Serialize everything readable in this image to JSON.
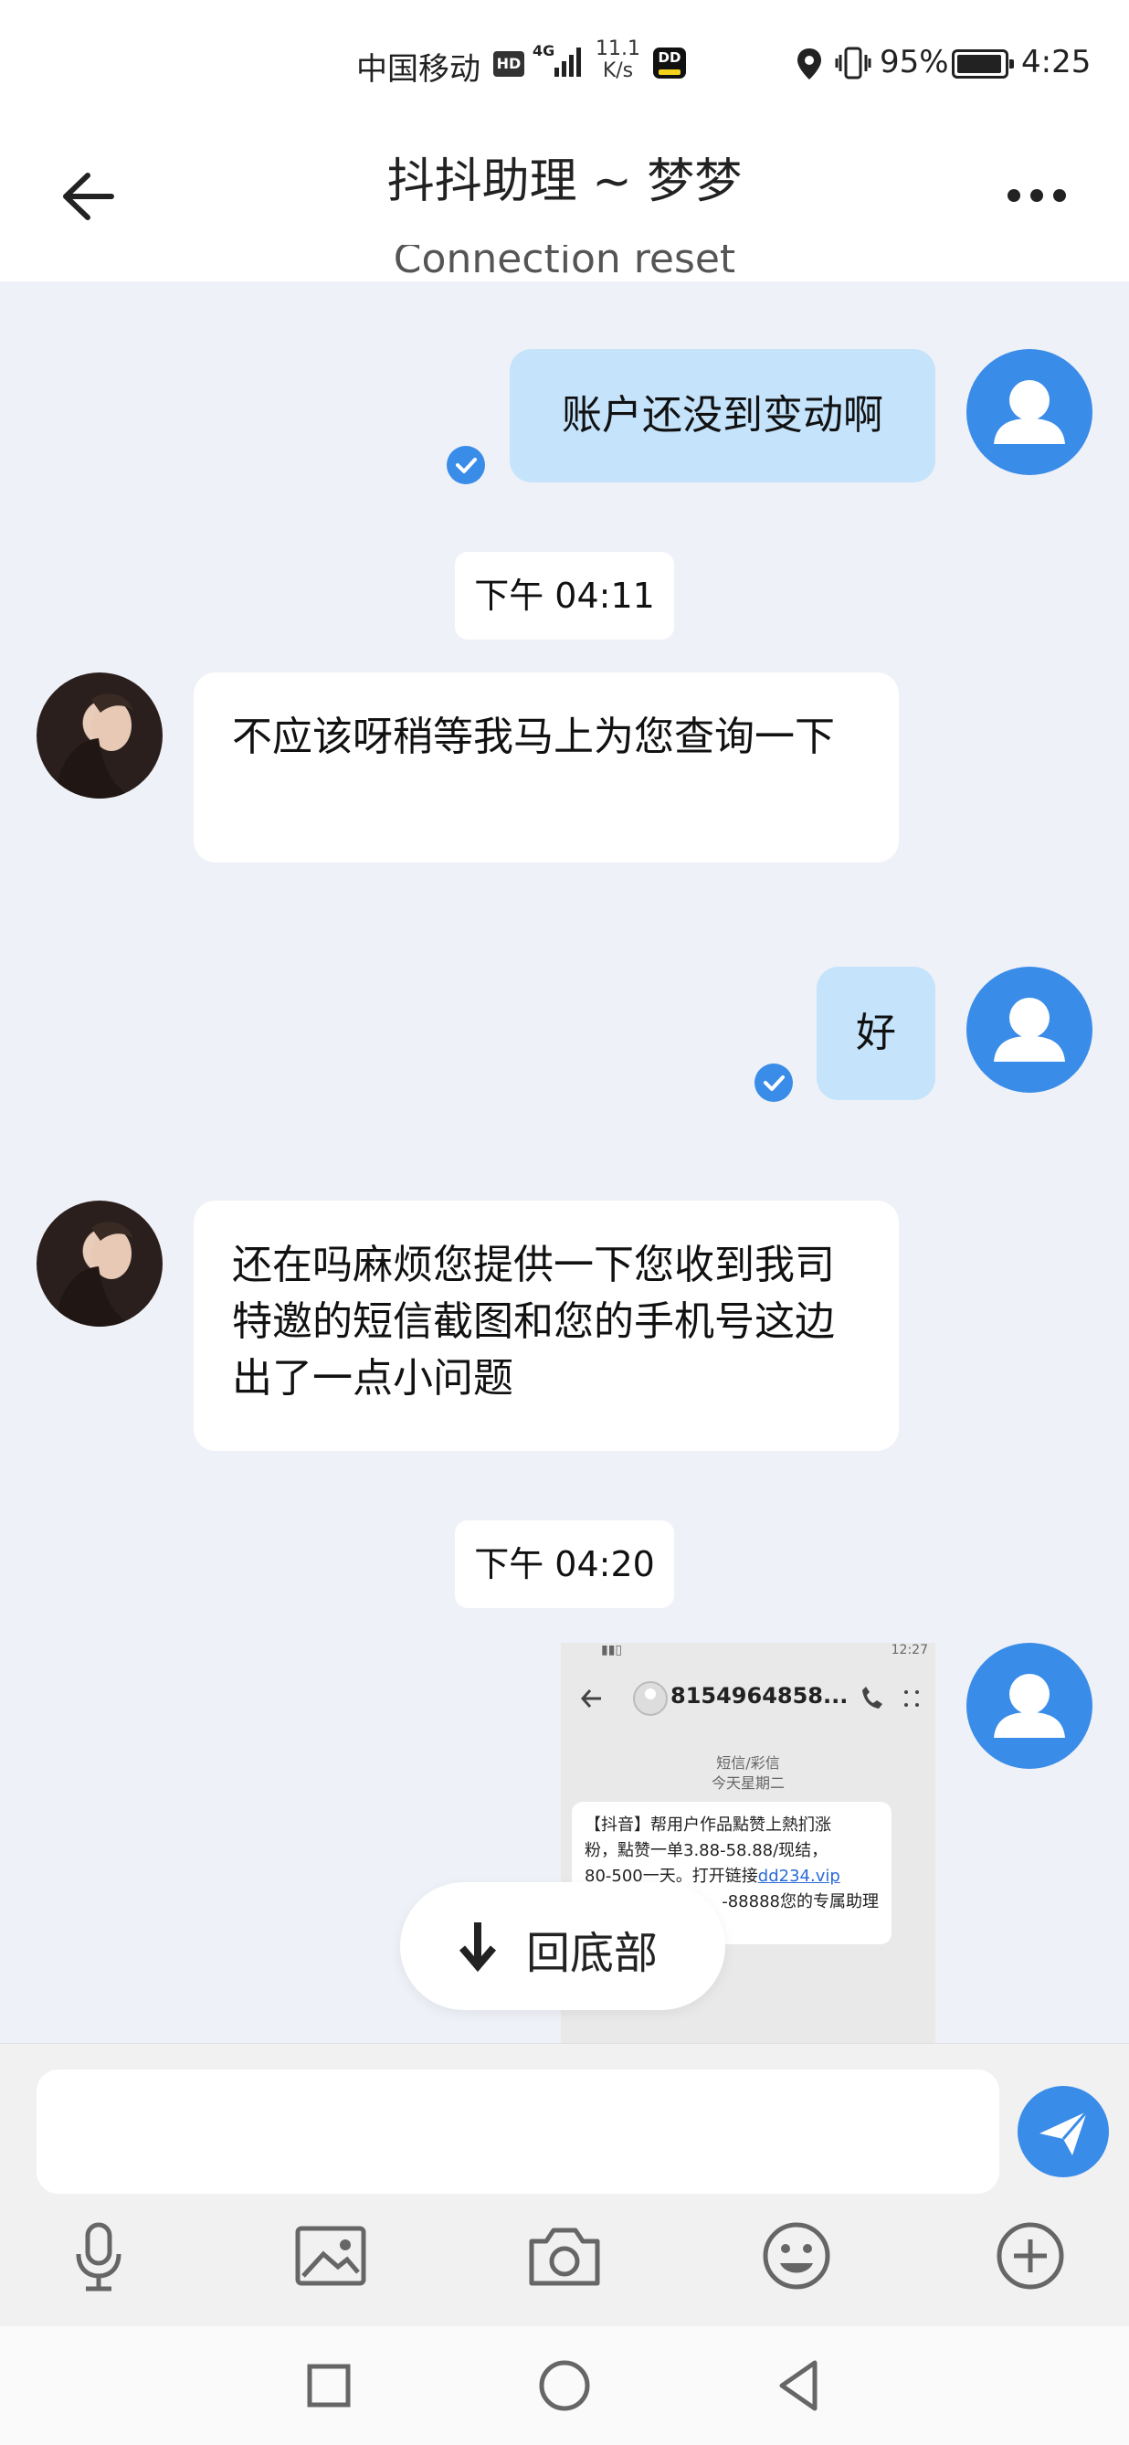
{
  "status_bar": {
    "carrier": "中国移动",
    "hd": "HD",
    "network": "4G",
    "speed_value": "11.1",
    "speed_unit": "K/s",
    "app_icon_text": "DD",
    "battery_percent": "95%",
    "time": "4:25"
  },
  "header": {
    "title": "抖抖助理 ~ 梦梦",
    "connection_notice": "Connection reset"
  },
  "messages": [
    {
      "from": "me",
      "text": "账户还没到变动啊"
    },
    {
      "type": "time",
      "text": "下午 04:11"
    },
    {
      "from": "her",
      "text": "不应该呀稍等我马上为您查询一下"
    },
    {
      "from": "me",
      "text": "好"
    },
    {
      "from": "her",
      "text": "还在吗麻烦您提供一下您收到我司特邀的短信截图和您的手机号这边出了一点小问题"
    },
    {
      "type": "time",
      "text": "下午 04:20"
    }
  ],
  "screenshot_message": {
    "status_time": "12:27",
    "number": "8154964858...",
    "type_label": "短信/彩信",
    "day_label": "今天星期二",
    "sms_line1": "【抖音】帮用户作品點赞上熱扪涨",
    "sms_line2": "粉，點赞一单3.88-58.88/现结，",
    "sms_line3_prefix": "80-500一天。打开链接",
    "sms_link": "dd234.vip",
    "sms_line4": "-88888您的专属助理"
  },
  "scroll_to_bottom_label": "回底部",
  "input": {
    "placeholder": "",
    "value": ""
  },
  "toolbar_icons": [
    "microphone-icon",
    "image-icon",
    "camera-icon",
    "emoji-icon",
    "plus-circle-icon"
  ],
  "colors": {
    "accent": "#3a8ce9",
    "my_bubble": "#c5e3fb",
    "background": "#eef1f7"
  }
}
